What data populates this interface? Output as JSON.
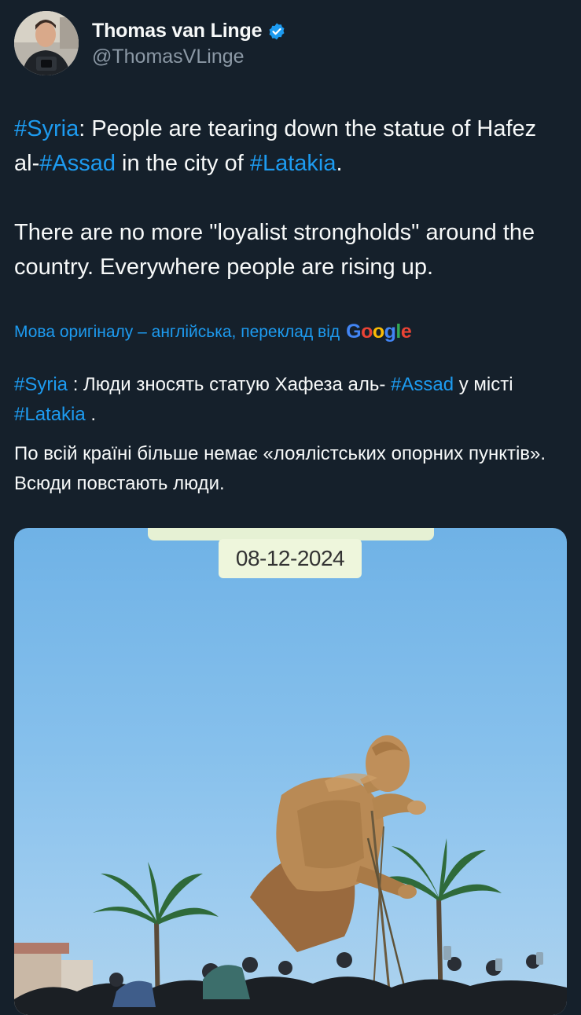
{
  "author": {
    "name": "Thomas van Linge",
    "handle": "@ThomasVLinge",
    "verified_icon": "verified-badge-icon",
    "avatar_icon": "avatar-photo"
  },
  "tweet": {
    "p1_tag1": "#Syria",
    "p1_a": ": People are tearing down the statue of Hafez al-",
    "p1_tag2": "#Assad",
    "p1_b": " in the city of ",
    "p1_tag3": "#Latakia",
    "p1_c": ".",
    "p2": "There are no more \"loyalist strongholds\" around the country. Everywhere people are rising up."
  },
  "translation": {
    "label": "Мова оригіналу – англійська, переклад від",
    "provider_g1": "G",
    "provider_o1": "o",
    "provider_o2": "o",
    "provider_g2": "g",
    "provider_l": "l",
    "provider_e": "e"
  },
  "translated": {
    "p1_tag1": "#Syria",
    "p1_a": " : Люди зносять статую Хафеза аль- ",
    "p1_tag2": "#Assad",
    "p1_b": " у місті ",
    "p1_tag3": "#Latakia",
    "p1_c": " .",
    "p2": "По всій країні більше немає «лоялістських опорних пунктів». Всюди повстають люди."
  },
  "media": {
    "date_stamp": "08-12-2024"
  },
  "colors": {
    "background": "#15202b",
    "link": "#1d9bf0",
    "secondary_text": "#8b98a5"
  }
}
